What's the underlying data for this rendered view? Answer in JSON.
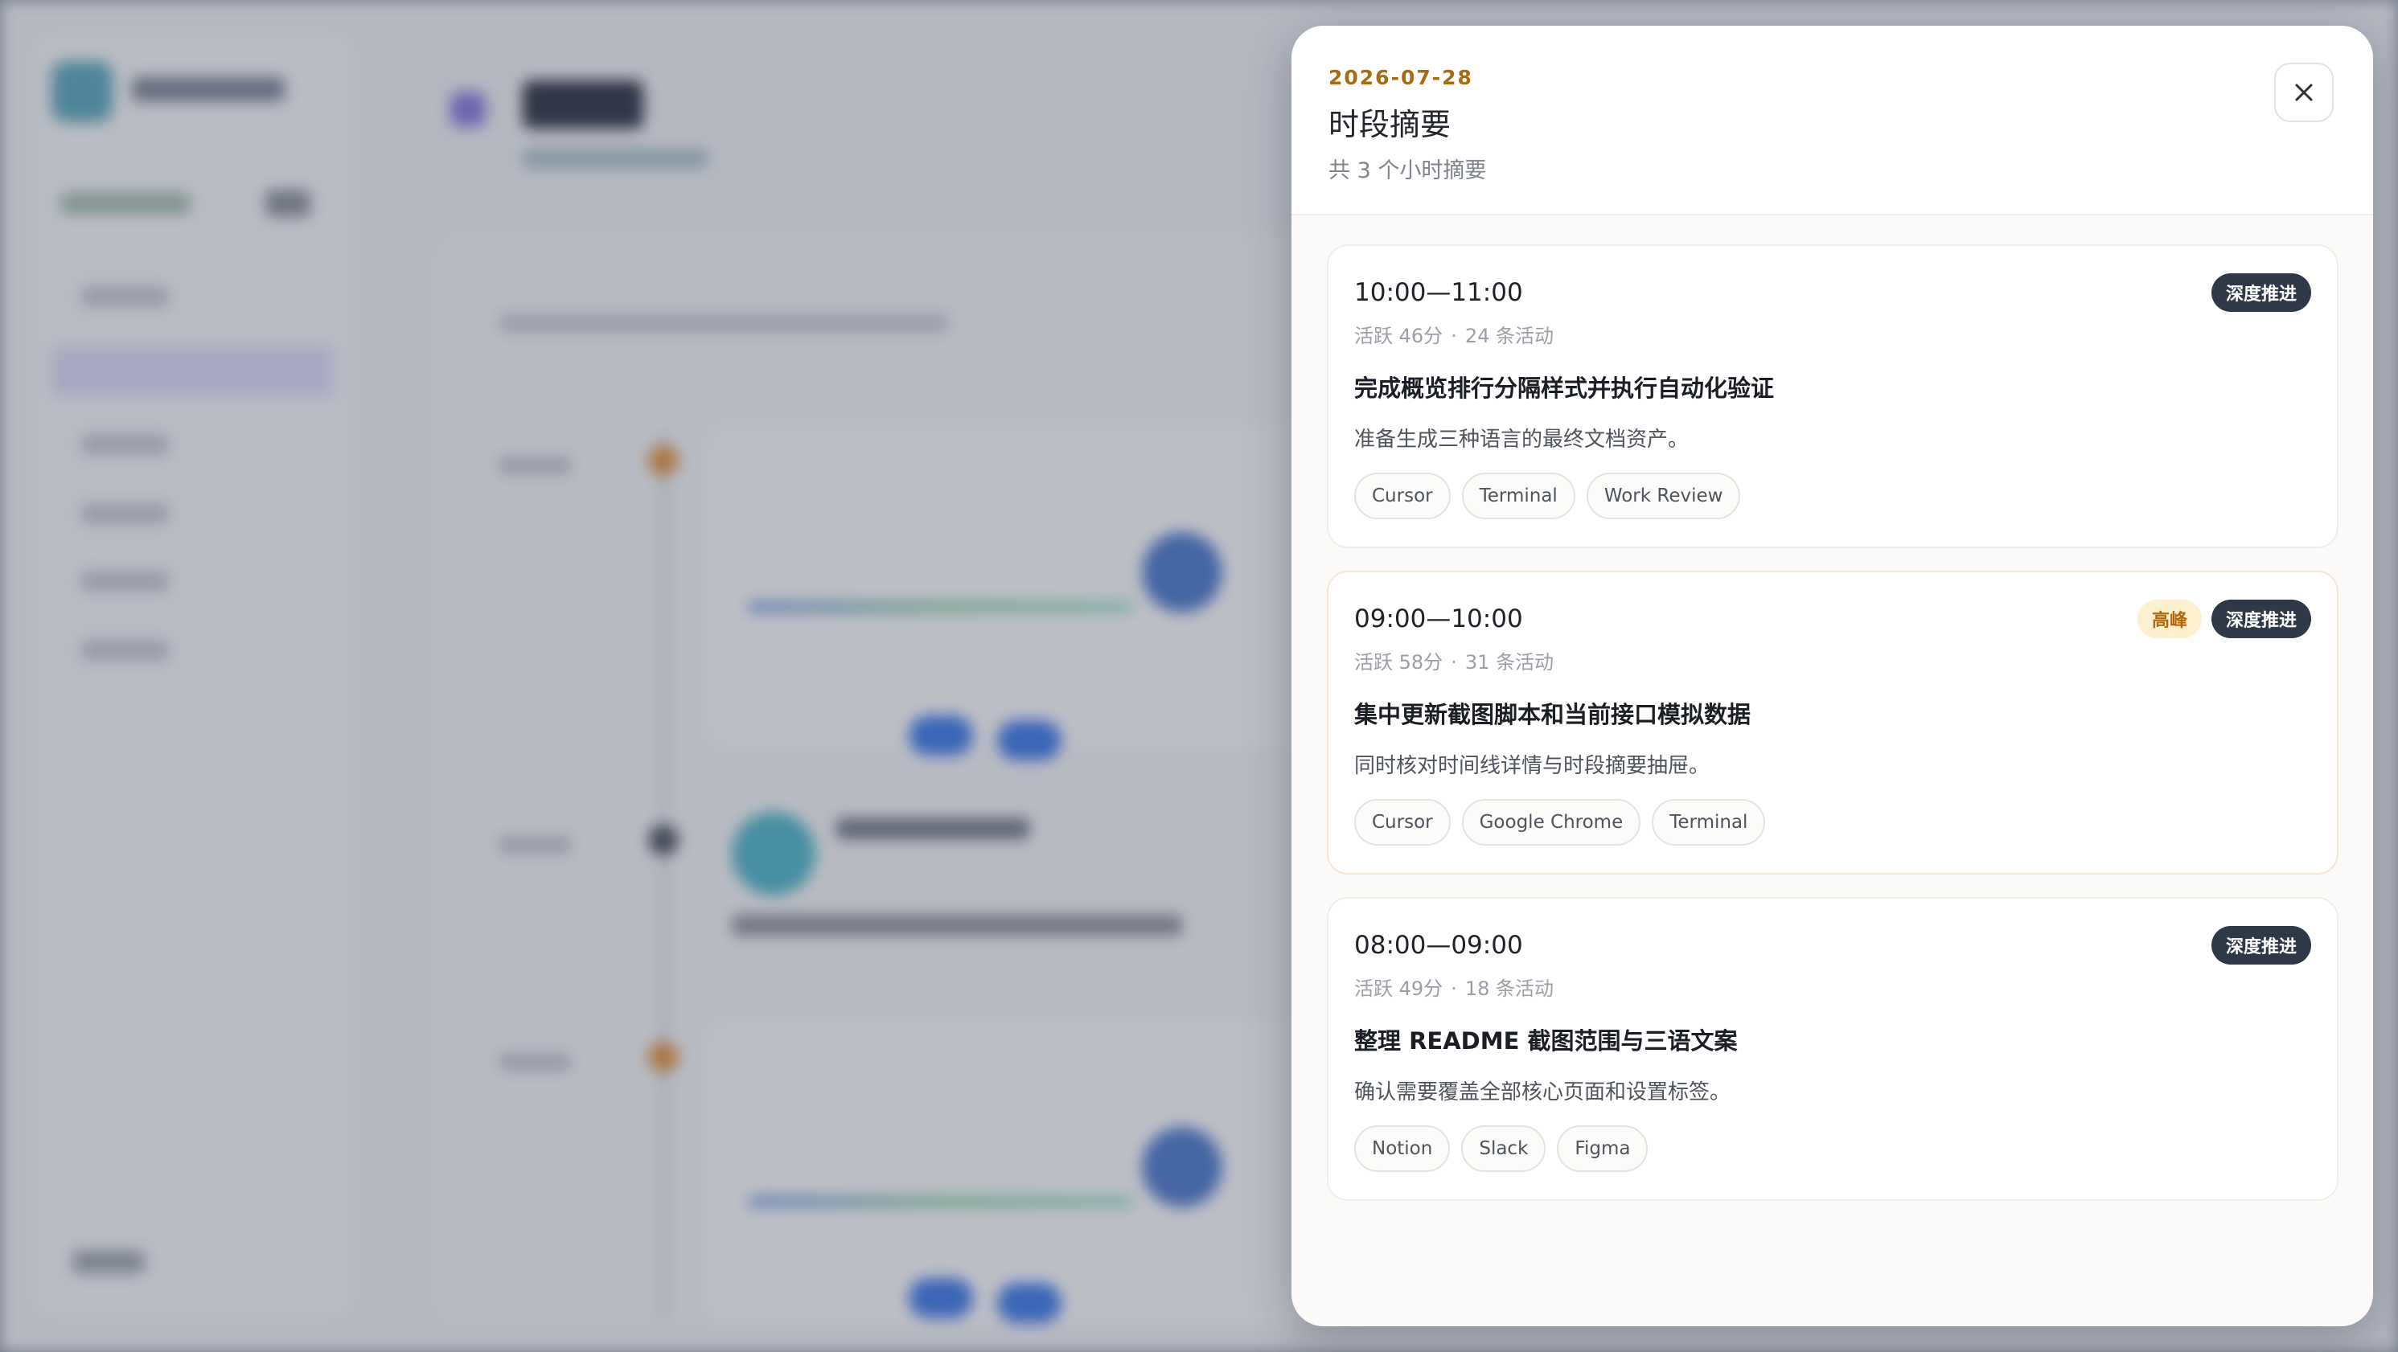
{
  "drawer": {
    "date": "2026-07-28",
    "title": "时段摘要",
    "subtitle": "共 3 个小时摘要",
    "close_icon": "close-icon"
  },
  "cards": [
    {
      "time": "10:00—11:00",
      "active": "活跃 46分",
      "activities": "24 条活动",
      "badge_peak": null,
      "badge_type": "深度推进",
      "headline": "完成概览排行分隔样式并执行自动化验证",
      "description": "准备生成三种语言的最终文档资产。",
      "tags": [
        "Cursor",
        "Terminal",
        "Work Review"
      ]
    },
    {
      "time": "09:00—10:00",
      "active": "活跃 58分",
      "activities": "31 条活动",
      "badge_peak": "高峰",
      "badge_type": "深度推进",
      "headline": "集中更新截图脚本和当前接口模拟数据",
      "description": "同时核对时间线详情与时段摘要抽屉。",
      "tags": [
        "Cursor",
        "Google Chrome",
        "Terminal"
      ]
    },
    {
      "time": "08:00—09:00",
      "active": "活跃 49分",
      "activities": "18 条活动",
      "badge_peak": null,
      "badge_type": "深度推进",
      "headline": "整理 README 截图范围与三语文案",
      "description": "确认需要覆盖全部核心页面和设置标签。",
      "tags": [
        "Notion",
        "Slack",
        "Figma"
      ]
    }
  ],
  "colors": {
    "date_accent": "#a86b10",
    "badge_dark": "#2f3846",
    "badge_peak_bg": "#fdf0cf",
    "badge_peak_text": "#b2680a"
  }
}
